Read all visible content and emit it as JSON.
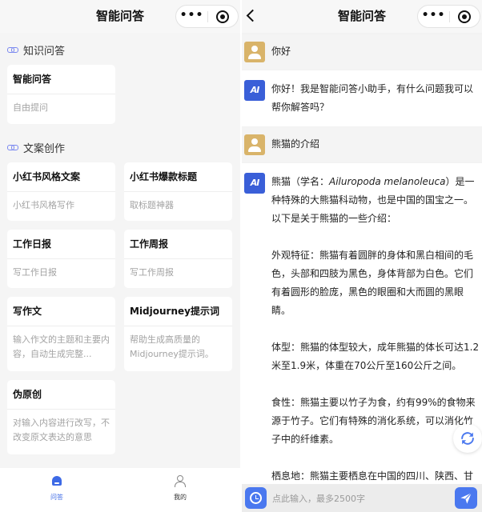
{
  "home": {
    "title": "智能问答",
    "capsule": {
      "more": "•••"
    },
    "sections": [
      {
        "title": "知识问答",
        "cards": [
          {
            "title": "智能问答",
            "desc": "自由提问"
          }
        ]
      },
      {
        "title": "文案创作",
        "cards": [
          {
            "title": "小红书风格文案",
            "desc": "小红书风格写作"
          },
          {
            "title": "小红书爆款标题",
            "desc": "取标题神器"
          },
          {
            "title": "工作日报",
            "desc": "写工作日报"
          },
          {
            "title": "工作周报",
            "desc": "写工作周报"
          },
          {
            "title": "写作文",
            "desc": "输入作文的主题和主要内容，自动生成完整..."
          },
          {
            "title": "Midjourney提示词",
            "desc": "帮助生成高质量的Midjourney提示词。"
          },
          {
            "title": "伪原创",
            "desc": "对输入内容进行改写，不改变原文表达的意思"
          }
        ]
      }
    ],
    "tabbar": [
      {
        "label": "问答",
        "icon": "home-icon",
        "active": true
      },
      {
        "label": "我的",
        "icon": "user-icon",
        "active": false
      }
    ]
  },
  "chat": {
    "title": "智能问答",
    "capsule": {
      "more": "•••"
    },
    "ai_avatar_text": "AI",
    "messages": [
      {
        "role": "user",
        "text": "你好"
      },
      {
        "role": "ai",
        "paragraphs": [
          "你好！我是智能问答小助手，有什么问题我可以帮你解答吗？"
        ]
      },
      {
        "role": "user",
        "text": "熊猫的介绍"
      },
      {
        "role": "ai",
        "intro_before": "熊猫（学名：",
        "intro_latin": "Ailuropoda melanoleuca",
        "intro_after": "）是一种特殊的大熊猫科动物，也是中国的国宝之一。以下是关于熊猫的一些介绍：",
        "paragraphs": [
          "外观特征：熊猫有着圆胖的身体和黑白相间的毛色，头部和四肢为黑色，身体背部为白色。它们有着圆形的脸庞，黑色的眼圈和大而圆的黑眼睛。",
          "体型：熊猫的体型较大，成年熊猫的体长可达1.2米至1.9米，体重在70公斤至160公斤之间。",
          "食性：熊猫主要以竹子为食，约有99%的食物来源于竹子。它们有特殊的消化系统，可以消化竹子中的纤维素。",
          "栖息地：熊猫主要栖息在中国的四川、陕西、甘"
        ]
      }
    ],
    "input_placeholder": "点此输入，最多2500字",
    "colors": {
      "accent": "#4a78ef",
      "user_avatar": "#d9b46a"
    }
  }
}
